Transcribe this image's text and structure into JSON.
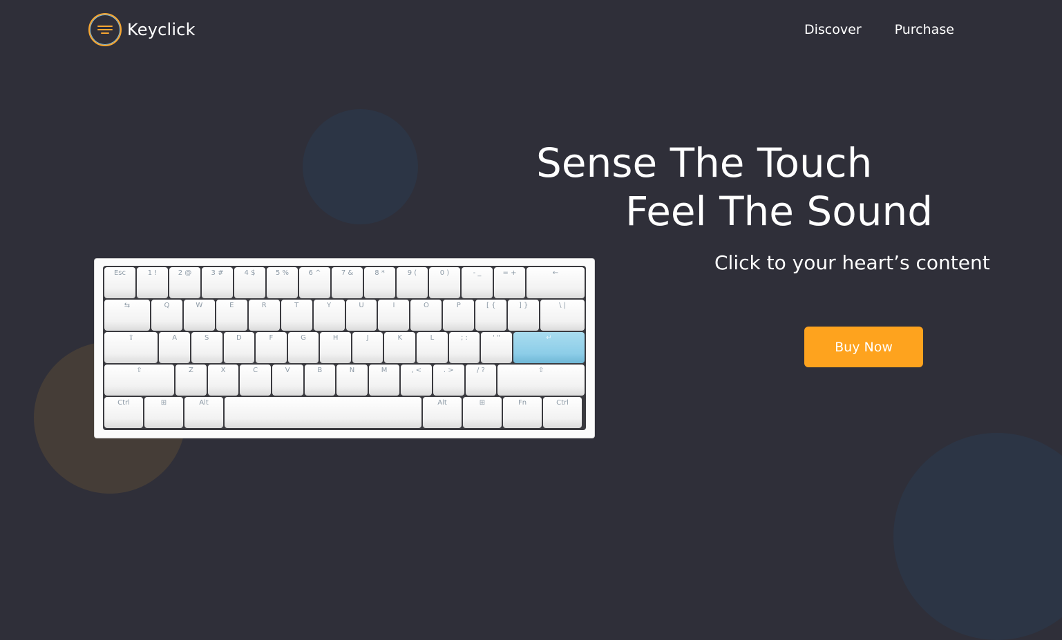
{
  "brand": {
    "name": "Keyclick",
    "logo_icon": "keycap-lines-icon",
    "accent": "#fea31e"
  },
  "nav": {
    "items": [
      {
        "label": "Discover"
      },
      {
        "label": "Purchase"
      }
    ]
  },
  "hero": {
    "line1": "Sense The Touch",
    "line2": "Feel The Sound",
    "tagline": "Click to your heart’s content",
    "cta_label": "Buy Now",
    "cta_color": "#fea31e"
  },
  "keyboard": {
    "rows": [
      [
        "Esc",
        "1 !",
        "2 @",
        "3 #",
        "4 $",
        "5 %",
        "6 ^",
        "7 &",
        "8 *",
        "9 (",
        "0 )",
        "- _",
        "= +",
        "←"
      ],
      [
        "⇆",
        "Q",
        "W",
        "E",
        "R",
        "T",
        "Y",
        "U",
        "I",
        "O",
        "P",
        "[ {",
        "] }",
        "\\ |"
      ],
      [
        "⇪",
        "A",
        "S",
        "D",
        "F",
        "G",
        "H",
        "J",
        "K",
        "L",
        "; :",
        "' \"",
        "↵"
      ],
      [
        "⇧",
        "Z",
        "X",
        "C",
        "V",
        "B",
        "N",
        "M",
        ", <",
        ". >",
        "/ ?",
        "⇧"
      ],
      [
        "Ctrl",
        "⊞",
        "Alt",
        "",
        "Alt",
        "⊞",
        "Fn",
        "Ctrl"
      ]
    ],
    "highlight_key": "↵",
    "highlight_color": "#8ccde8"
  },
  "colors": {
    "background": "#2f2f39",
    "blob_blue": "#2c3545",
    "blob_brown": "#453d37"
  }
}
